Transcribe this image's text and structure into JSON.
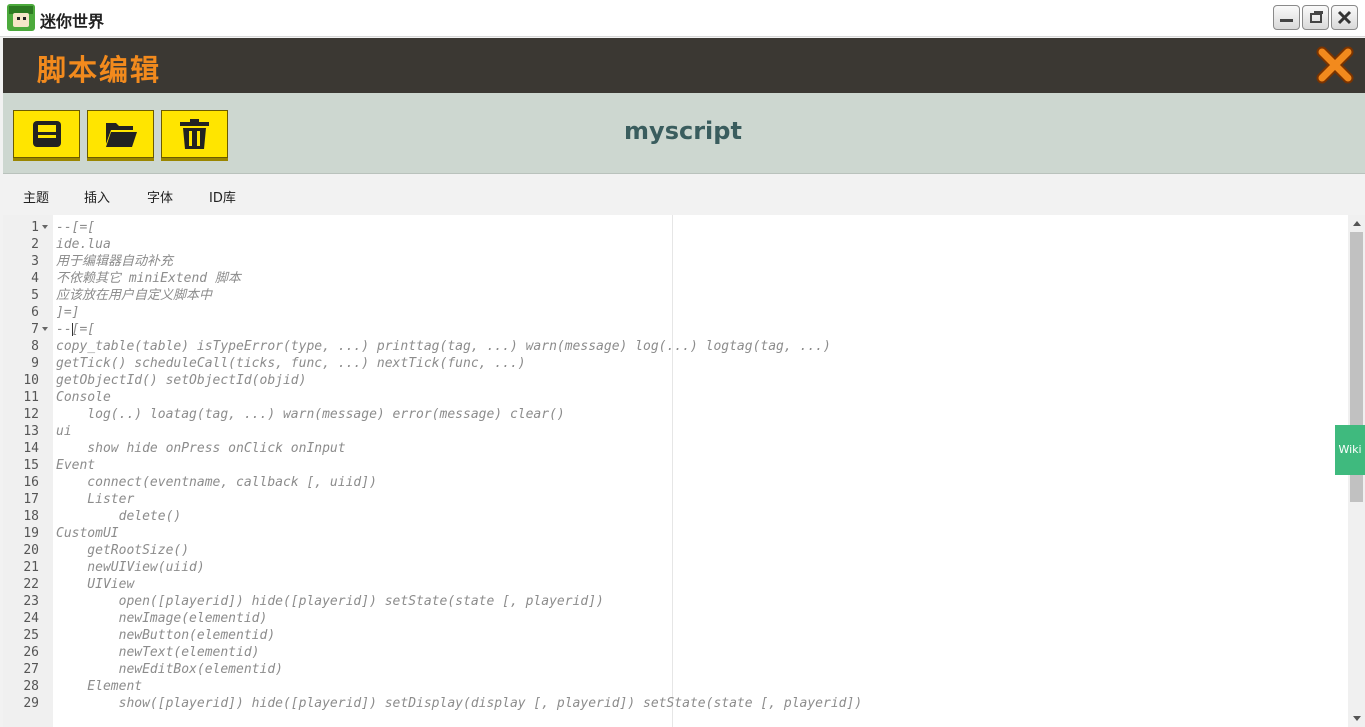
{
  "window": {
    "title": "迷你世界",
    "minimize_icon": "minimize-icon",
    "restore_icon": "restore-icon",
    "close_icon": "close-icon"
  },
  "panel": {
    "title": "脚本编辑",
    "close_icon": "close-x-icon",
    "accent_color": "#f28a1d"
  },
  "toolbar": {
    "save_icon": "save-icon",
    "open_icon": "folder-open-icon",
    "delete_icon": "trash-icon",
    "script_name": "myscript"
  },
  "menu": {
    "items": [
      "主题",
      "插入",
      "字体",
      "ID库"
    ]
  },
  "editor": {
    "lines": [
      {
        "n": "1",
        "text": "--[=[",
        "fold": true
      },
      {
        "n": "2",
        "text": "ide.lua"
      },
      {
        "n": "3",
        "text": "用于编辑器自动补充"
      },
      {
        "n": "4",
        "text": "不依赖其它 miniExtend 脚本"
      },
      {
        "n": "5",
        "text": "应该放在用户自定义脚本中"
      },
      {
        "n": "6",
        "text": "]=]"
      },
      {
        "n": "7",
        "text": "--[=[",
        "fold": true
      },
      {
        "n": "8",
        "text": "copy_table(table) isTypeError(type, ...) printtag(tag, ...) warn(message) log(...) logtag(tag, ...)"
      },
      {
        "n": "9",
        "text": "getTick() scheduleCall(ticks, func, ...) nextTick(func, ...)"
      },
      {
        "n": "10",
        "text": "getObjectId() setObjectId(objid)"
      },
      {
        "n": "11",
        "text": "Console"
      },
      {
        "n": "12",
        "text": "    log(..) loatag(tag, ...) warn(message) error(message) clear()"
      },
      {
        "n": "13",
        "text": "ui"
      },
      {
        "n": "14",
        "text": "    show hide onPress onClick onInput"
      },
      {
        "n": "15",
        "text": "Event"
      },
      {
        "n": "16",
        "text": "    connect(eventname, callback [, uiid])"
      },
      {
        "n": "17",
        "text": "    Lister"
      },
      {
        "n": "18",
        "text": "        delete()"
      },
      {
        "n": "19",
        "text": "CustomUI"
      },
      {
        "n": "20",
        "text": "    getRootSize()"
      },
      {
        "n": "21",
        "text": "    newUIView(uiid)"
      },
      {
        "n": "22",
        "text": "    UIView"
      },
      {
        "n": "23",
        "text": "        open([playerid]) hide([playerid]) setState(state [, playerid])"
      },
      {
        "n": "24",
        "text": "        newImage(elementid)"
      },
      {
        "n": "25",
        "text": "        newButton(elementid)"
      },
      {
        "n": "26",
        "text": "        newText(elementid)"
      },
      {
        "n": "27",
        "text": "        newEditBox(elementid)"
      },
      {
        "n": "28",
        "text": "    Element"
      },
      {
        "n": "29",
        "text": "        show([playerid]) hide([playerid]) setDisplay(display [, playerid]) setState(state [, playerid])"
      }
    ]
  },
  "side_tab": {
    "label": "Wiki",
    "color": "#3fba7e"
  }
}
